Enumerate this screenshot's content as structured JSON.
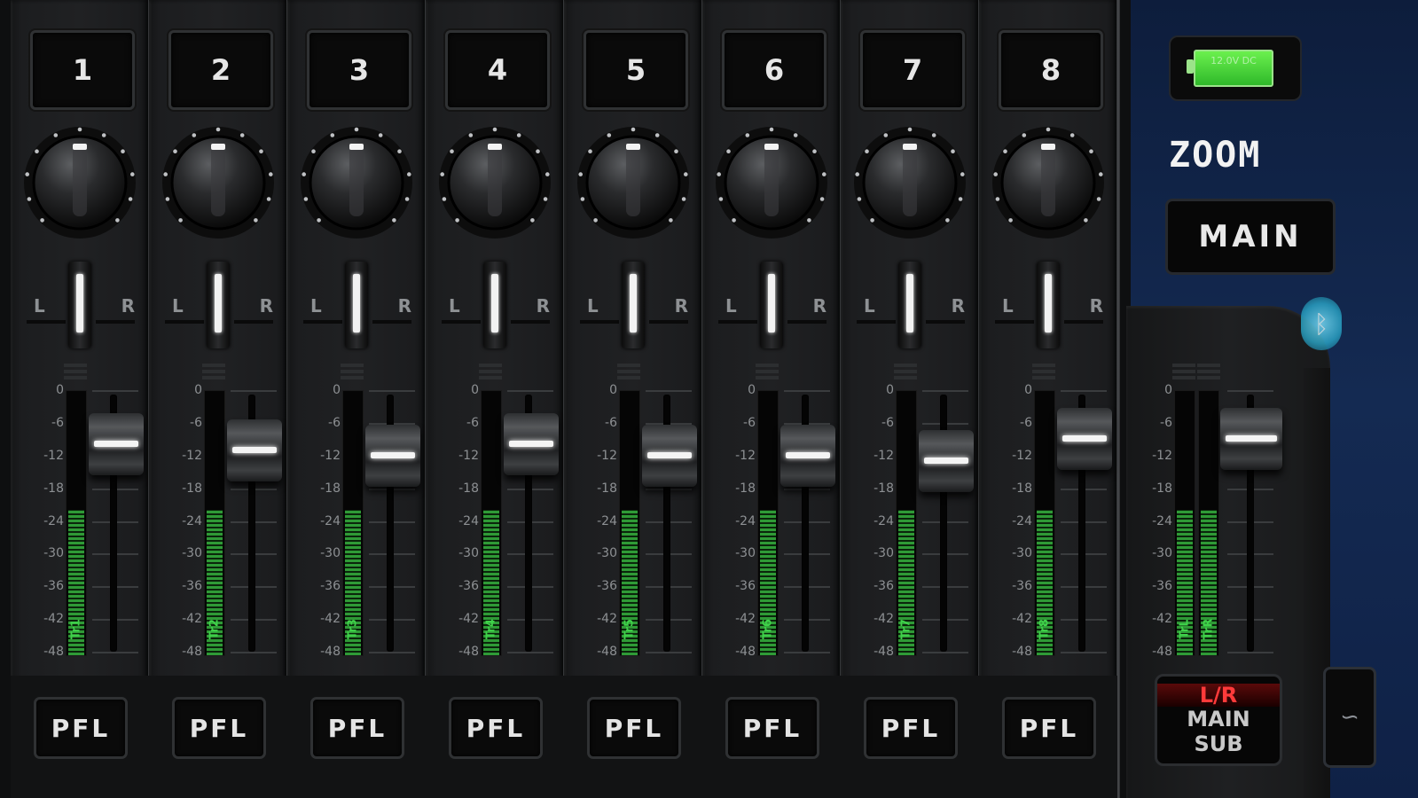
{
  "channels": [
    {
      "number": "1",
      "track": "Tr1",
      "fader_db": -10,
      "meter_level": 0.55
    },
    {
      "number": "2",
      "track": "Tr2",
      "fader_db": -11,
      "meter_level": 0.55
    },
    {
      "number": "3",
      "track": "Tr3",
      "fader_db": -12,
      "meter_level": 0.55
    },
    {
      "number": "4",
      "track": "Tr4",
      "fader_db": -10,
      "meter_level": 0.55
    },
    {
      "number": "5",
      "track": "Tr5",
      "fader_db": -12,
      "meter_level": 0.55
    },
    {
      "number": "6",
      "track": "Tr6",
      "fader_db": -12,
      "meter_level": 0.55
    },
    {
      "number": "7",
      "track": "Tr7",
      "fader_db": -13,
      "meter_level": 0.55
    },
    {
      "number": "8",
      "track": "Tr8",
      "fader_db": -9,
      "meter_level": 0.55
    }
  ],
  "scale_labels": [
    "0",
    "-6",
    "-12",
    "-18",
    "-24",
    "-30",
    "-36",
    "-42",
    "-48"
  ],
  "pan_left_label": "L",
  "pan_right_label": "R",
  "pfl_label": "PFL",
  "master": {
    "track_left": "TrL",
    "track_right": "TrR",
    "fader_db": -9,
    "meter_level": 0.55
  },
  "battery_label": "12.0V DC",
  "brand": "ZOOM",
  "main_label": "MAIN",
  "bluetooth_icon": "bluetooth-icon",
  "lr_button": {
    "line1": "L/R",
    "line2": "MAIN",
    "line3": "SUB"
  },
  "side_button_icon": "wave-icon",
  "colors": {
    "meter_green": "#2f9a36",
    "panel_blue": "#142a52",
    "bat_green": "#4fd43a",
    "lr_red": "#ff3a3a"
  }
}
